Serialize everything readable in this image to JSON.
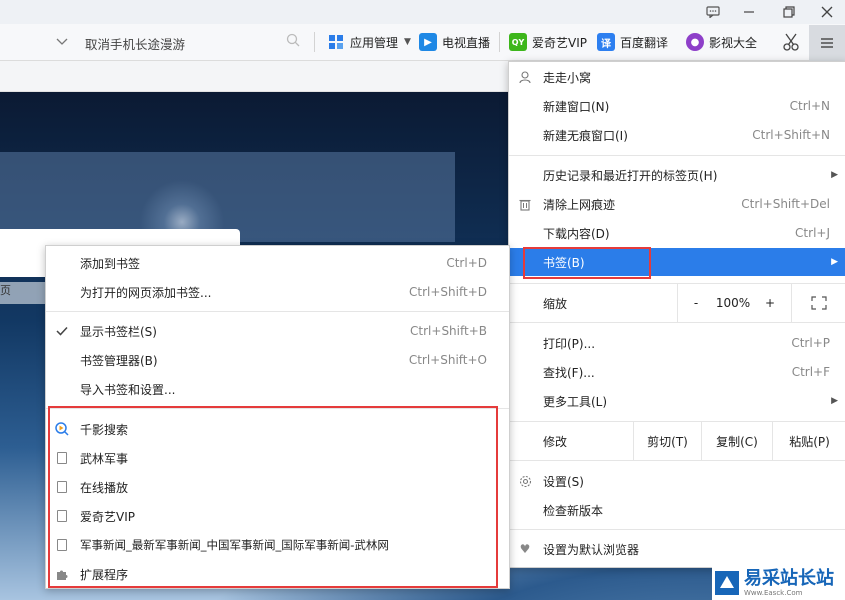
{
  "window": {
    "feedback_icon": "feedback-icon",
    "min_icon": "minimize-icon",
    "restore_icon": "restore-icon",
    "close_icon": "close-icon"
  },
  "toolbar": {
    "address_text": "取消手机长途漫游",
    "items": [
      {
        "label": "应用管理",
        "icon": "apps-grid-icon",
        "color": "#2b7de9"
      },
      {
        "label": "电视直播",
        "icon": "tv-play-icon",
        "color": "#1e88e5"
      },
      {
        "label": "爱奇艺VIP",
        "icon": "iqiyi-icon",
        "color": "#3db61b"
      },
      {
        "label": "百度翻译",
        "icon": "translate-icon",
        "color": "#2d7ff0"
      },
      {
        "label": "影视大全",
        "icon": "film-icon",
        "color": "#8e3fc9"
      }
    ]
  },
  "main_menu": {
    "user": "走走小窝",
    "new_window": {
      "label": "新建窗口(N)",
      "shortcut": "Ctrl+N"
    },
    "new_incognito": {
      "label": "新建无痕窗口(I)",
      "shortcut": "Ctrl+Shift+N"
    },
    "history": {
      "label": "历史记录和最近打开的标签页(H)"
    },
    "clear": {
      "label": "清除上网痕迹",
      "shortcut": "Ctrl+Shift+Del"
    },
    "downloads": {
      "label": "下载内容(D)",
      "shortcut": "Ctrl+J"
    },
    "bookmarks": {
      "label": "书签(B)"
    },
    "zoom": {
      "label": "缩放",
      "minus": "-",
      "value": "100%",
      "plus": "+"
    },
    "print": {
      "label": "打印(P)...",
      "shortcut": "Ctrl+P"
    },
    "find": {
      "label": "查找(F)...",
      "shortcut": "Ctrl+F"
    },
    "more_tools": {
      "label": "更多工具(L)"
    },
    "edit": {
      "label": "修改",
      "cut": "剪切(T)",
      "copy": "复制(C)",
      "paste": "粘贴(P)"
    },
    "settings": {
      "label": "设置(S)"
    },
    "check_update": {
      "label": "检查新版本"
    },
    "default_browser": {
      "label": "设置为默认浏览器"
    }
  },
  "bookmark_menu": {
    "add": {
      "label": "添加到书签",
      "shortcut": "Ctrl+D"
    },
    "add_all": {
      "label": "为打开的网页添加书签...",
      "shortcut": "Ctrl+Shift+D"
    },
    "show_bar": {
      "label": "显示书签栏(S)",
      "shortcut": "Ctrl+Shift+B"
    },
    "manager": {
      "label": "书签管理器(B)",
      "shortcut": "Ctrl+Shift+O"
    },
    "import": {
      "label": "导入书签和设置..."
    },
    "items": [
      "千影搜索",
      "武林军事",
      "在线播放",
      "爱奇艺VIP",
      "军事新闻_最新军事新闻_中国军事新闻_国际军事新闻-武林网",
      "扩展程序"
    ]
  },
  "page": {
    "edge_text": "页"
  },
  "watermark": {
    "text": "易采站长站",
    "sub": "Www.Easck.Com"
  },
  "colors": {
    "highlight": "#2b7de9",
    "annotation_red": "#e53b3b"
  }
}
